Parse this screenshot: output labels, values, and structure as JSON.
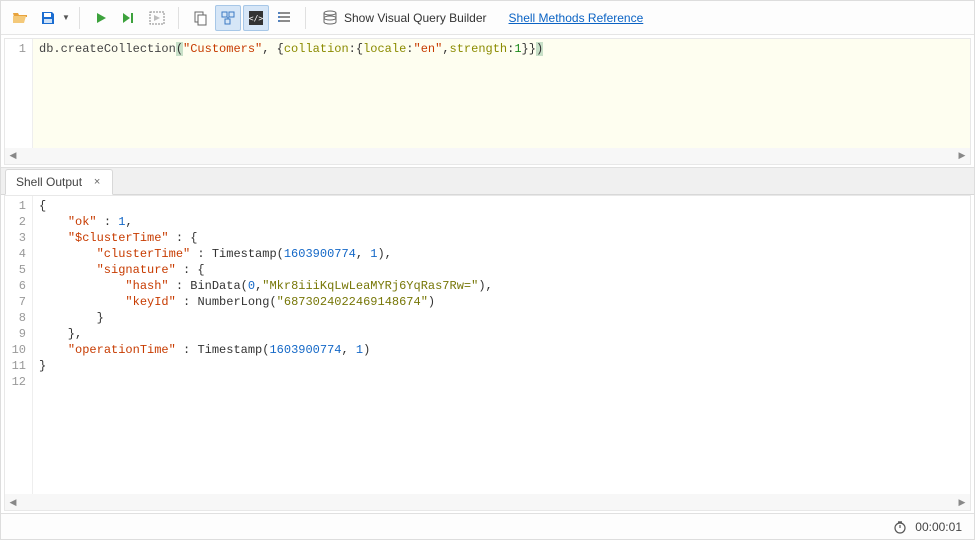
{
  "toolbar": {
    "visual_query_builder_label": "Show Visual Query Builder",
    "shell_reference_label": "Shell Methods Reference"
  },
  "editor": {
    "lines": [
      {
        "n": "1",
        "tokens": [
          {
            "t": "db",
            "c": "tok-builtin"
          },
          {
            "t": ".",
            "c": "tok-punc"
          },
          {
            "t": "createCollection",
            "c": "tok-func"
          },
          {
            "t": "(",
            "c": "tok-punc tok-paren-hl"
          },
          {
            "t": "\"Customers\"",
            "c": "tok-str"
          },
          {
            "t": ", {",
            "c": "tok-punc"
          },
          {
            "t": "collation",
            "c": "tok-key"
          },
          {
            "t": ":{",
            "c": "tok-punc"
          },
          {
            "t": "locale",
            "c": "tok-key"
          },
          {
            "t": ":",
            "c": "tok-punc"
          },
          {
            "t": "\"en\"",
            "c": "tok-str"
          },
          {
            "t": ",",
            "c": "tok-punc"
          },
          {
            "t": "strength",
            "c": "tok-key"
          },
          {
            "t": ":",
            "c": "tok-punc"
          },
          {
            "t": "1",
            "c": "tok-num"
          },
          {
            "t": "}}",
            "c": "tok-punc"
          },
          {
            "t": ")",
            "c": "tok-punc tok-paren-hl"
          }
        ]
      }
    ]
  },
  "tab": {
    "label": "Shell Output",
    "close": "×"
  },
  "output": {
    "lines": [
      {
        "n": "1",
        "tokens": [
          {
            "t": "{",
            "c": "tok-punc"
          }
        ]
      },
      {
        "n": "2",
        "tokens": [
          {
            "t": "    ",
            "c": ""
          },
          {
            "t": "\"ok\"",
            "c": "tok-str"
          },
          {
            "t": " : ",
            "c": "tok-punc"
          },
          {
            "t": "1",
            "c": "tok-blue"
          },
          {
            "t": ",",
            "c": "tok-punc"
          }
        ]
      },
      {
        "n": "3",
        "tokens": [
          {
            "t": "    ",
            "c": ""
          },
          {
            "t": "\"$clusterTime\"",
            "c": "tok-str"
          },
          {
            "t": " : {",
            "c": "tok-punc"
          }
        ]
      },
      {
        "n": "4",
        "tokens": [
          {
            "t": "        ",
            "c": ""
          },
          {
            "t": "\"clusterTime\"",
            "c": "tok-str"
          },
          {
            "t": " : Timestamp(",
            "c": "tok-punc"
          },
          {
            "t": "1603900774",
            "c": "tok-blue"
          },
          {
            "t": ", ",
            "c": "tok-punc"
          },
          {
            "t": "1",
            "c": "tok-blue"
          },
          {
            "t": "),",
            "c": "tok-punc"
          }
        ]
      },
      {
        "n": "5",
        "tokens": [
          {
            "t": "        ",
            "c": ""
          },
          {
            "t": "\"signature\"",
            "c": "tok-str"
          },
          {
            "t": " : {",
            "c": "tok-punc"
          }
        ]
      },
      {
        "n": "6",
        "tokens": [
          {
            "t": "            ",
            "c": ""
          },
          {
            "t": "\"hash\"",
            "c": "tok-str"
          },
          {
            "t": " : BinData(",
            "c": "tok-punc"
          },
          {
            "t": "0",
            "c": "tok-blue"
          },
          {
            "t": ",",
            "c": "tok-punc"
          },
          {
            "t": "\"Mkr8iiiKqLwLeaMYRj6YqRas7Rw=\"",
            "c": "tok-key2"
          },
          {
            "t": "),",
            "c": "tok-punc"
          }
        ]
      },
      {
        "n": "7",
        "tokens": [
          {
            "t": "            ",
            "c": ""
          },
          {
            "t": "\"keyId\"",
            "c": "tok-str"
          },
          {
            "t": " : NumberLong(",
            "c": "tok-punc"
          },
          {
            "t": "\"6873024022469148674\"",
            "c": "tok-key2"
          },
          {
            "t": ")",
            "c": "tok-punc"
          }
        ]
      },
      {
        "n": "8",
        "tokens": [
          {
            "t": "        }",
            "c": "tok-punc"
          }
        ]
      },
      {
        "n": "9",
        "tokens": [
          {
            "t": "    },",
            "c": "tok-punc"
          }
        ]
      },
      {
        "n": "10",
        "tokens": [
          {
            "t": "    ",
            "c": ""
          },
          {
            "t": "\"operationTime\"",
            "c": "tok-str"
          },
          {
            "t": " : Timestamp(",
            "c": "tok-punc"
          },
          {
            "t": "1603900774",
            "c": "tok-blue"
          },
          {
            "t": ", ",
            "c": "tok-punc"
          },
          {
            "t": "1",
            "c": "tok-blue"
          },
          {
            "t": ")",
            "c": "tok-punc"
          }
        ]
      },
      {
        "n": "11",
        "tokens": [
          {
            "t": "}",
            "c": "tok-punc"
          }
        ]
      },
      {
        "n": "12",
        "tokens": []
      }
    ]
  },
  "status": {
    "elapsed": "00:00:01"
  }
}
